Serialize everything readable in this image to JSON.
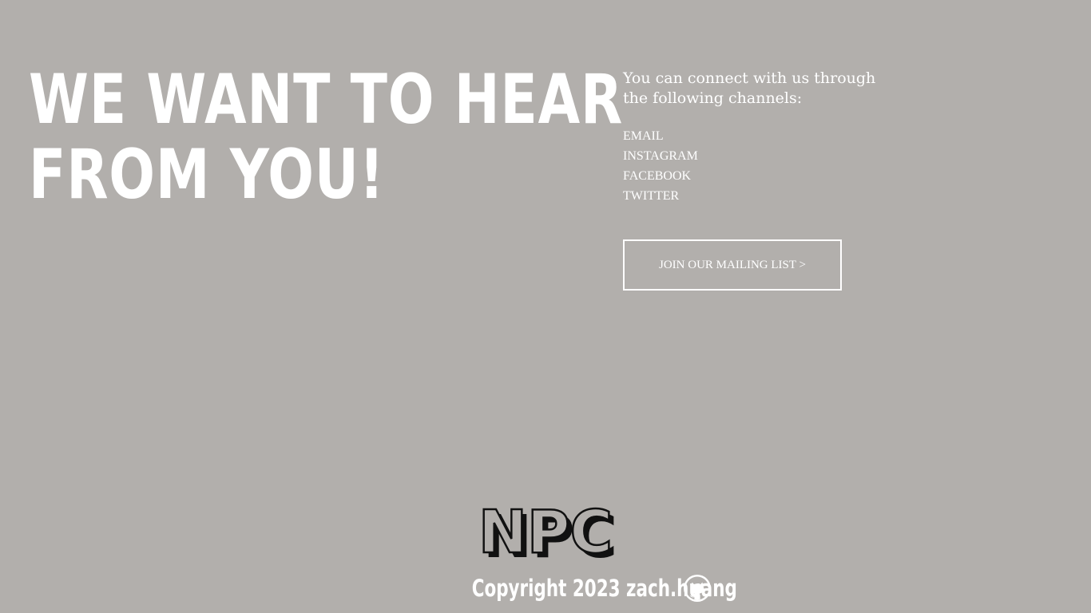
{
  "headline": {
    "line1": "WE WANT TO HEAR",
    "line2": "FROM YOU!"
  },
  "contact": {
    "intro_line1": "You can connect with us through",
    "intro_line2": "the following channels:",
    "channels": [
      "EMAIL",
      "INSTAGRAM",
      "FACEBOOK",
      "TWITTER"
    ],
    "mailing_button": "JOIN OUR MAILING LIST >"
  },
  "logo": {
    "text": "NPC"
  },
  "footer": {
    "copyright": "Copyright 2023 zach.huang",
    "icon": "github-icon"
  },
  "colors": {
    "background": "#b2afac",
    "text": "#ffffff",
    "logo_shadow": "#111111"
  }
}
